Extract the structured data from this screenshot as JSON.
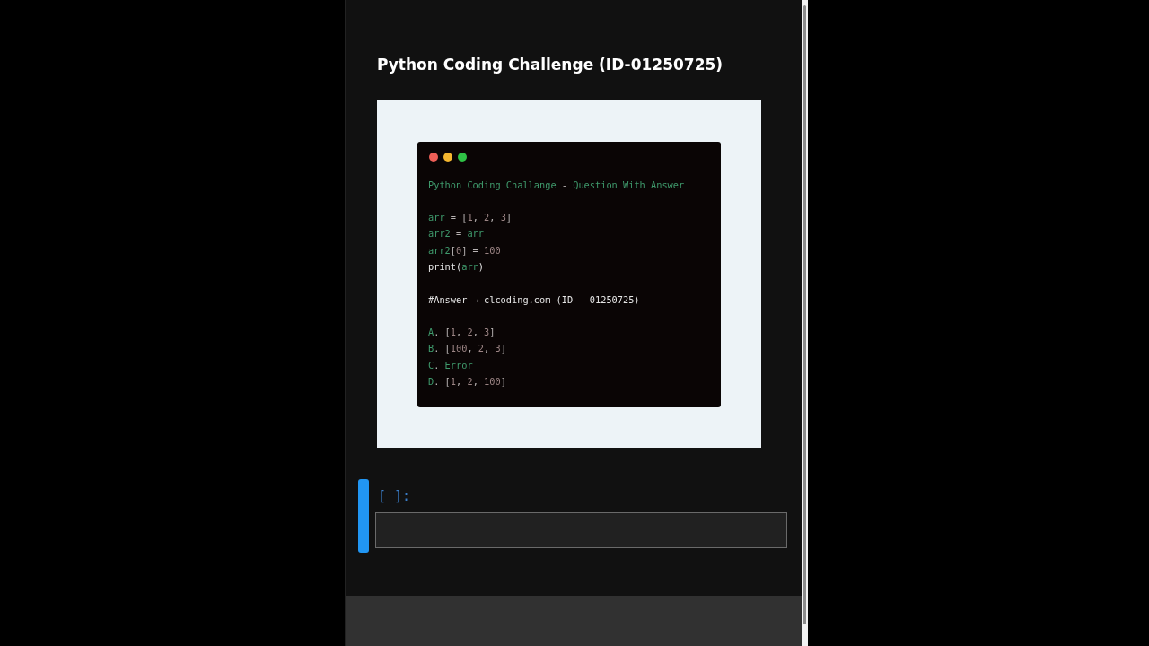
{
  "notebook": {
    "title": "Python Coding Challenge (ID-01250725)",
    "code_image": {
      "dots": [
        {
          "color": "#ee5f57"
        },
        {
          "color": "#f4b62f"
        },
        {
          "color": "#2fc246"
        }
      ],
      "blocks": [
        {
          "lines": [
            {
              "tokens": [
                {
                  "text": "Python Coding Challange",
                  "kind": "name"
                },
                {
                  "text": " - ",
                  "kind": "plain"
                },
                {
                  "text": "Question With Answer",
                  "kind": "name"
                }
              ]
            }
          ]
        },
        {
          "lines": [
            {
              "tokens": [
                {
                  "text": "arr",
                  "kind": "name"
                },
                {
                  "text": " = [",
                  "kind": "plain"
                },
                {
                  "text": "1",
                  "kind": "num"
                },
                {
                  "text": ", ",
                  "kind": "plain"
                },
                {
                  "text": "2",
                  "kind": "num"
                },
                {
                  "text": ", ",
                  "kind": "plain"
                },
                {
                  "text": "3",
                  "kind": "num"
                },
                {
                  "text": "]",
                  "kind": "plain"
                }
              ]
            },
            {
              "tokens": [
                {
                  "text": "arr2",
                  "kind": "name"
                },
                {
                  "text": " = ",
                  "kind": "plain"
                },
                {
                  "text": "arr",
                  "kind": "name"
                }
              ]
            },
            {
              "tokens": [
                {
                  "text": "arr2",
                  "kind": "name"
                },
                {
                  "text": "[",
                  "kind": "plain"
                },
                {
                  "text": "0",
                  "kind": "num"
                },
                {
                  "text": "] = ",
                  "kind": "plain"
                },
                {
                  "text": "100",
                  "kind": "num"
                }
              ]
            },
            {
              "tokens": [
                {
                  "text": "print(",
                  "kind": "bright"
                },
                {
                  "text": "arr",
                  "kind": "name"
                },
                {
                  "text": ")",
                  "kind": "bright"
                }
              ]
            }
          ]
        },
        {
          "lines": [
            {
              "tokens": [
                {
                  "text": "#Answer ⟶ clcoding.com (ID - 01250725)",
                  "kind": "bright"
                }
              ]
            }
          ]
        },
        {
          "lines": [
            {
              "tokens": [
                {
                  "text": "A",
                  "kind": "name"
                },
                {
                  "text": ". [",
                  "kind": "plain"
                },
                {
                  "text": "1",
                  "kind": "num"
                },
                {
                  "text": ", ",
                  "kind": "plain"
                },
                {
                  "text": "2",
                  "kind": "num"
                },
                {
                  "text": ", ",
                  "kind": "plain"
                },
                {
                  "text": "3",
                  "kind": "num"
                },
                {
                  "text": "]",
                  "kind": "plain"
                }
              ]
            },
            {
              "tokens": [
                {
                  "text": "B",
                  "kind": "name"
                },
                {
                  "text": ". [",
                  "kind": "plain"
                },
                {
                  "text": "100",
                  "kind": "num"
                },
                {
                  "text": ", ",
                  "kind": "plain"
                },
                {
                  "text": "2",
                  "kind": "num"
                },
                {
                  "text": ", ",
                  "kind": "plain"
                },
                {
                  "text": "3",
                  "kind": "num"
                },
                {
                  "text": "]",
                  "kind": "plain"
                }
              ]
            },
            {
              "tokens": [
                {
                  "text": "C",
                  "kind": "name"
                },
                {
                  "text": ". ",
                  "kind": "plain"
                },
                {
                  "text": "Error",
                  "kind": "name"
                }
              ]
            },
            {
              "tokens": [
                {
                  "text": "D",
                  "kind": "name"
                },
                {
                  "text": ". [",
                  "kind": "plain"
                },
                {
                  "text": "1",
                  "kind": "num"
                },
                {
                  "text": ", ",
                  "kind": "plain"
                },
                {
                  "text": "2",
                  "kind": "num"
                },
                {
                  "text": ", ",
                  "kind": "plain"
                },
                {
                  "text": "100",
                  "kind": "num"
                },
                {
                  "text": "]",
                  "kind": "plain"
                }
              ]
            }
          ]
        }
      ]
    },
    "cell": {
      "prompt": "[ ]:",
      "selected": true
    }
  }
}
